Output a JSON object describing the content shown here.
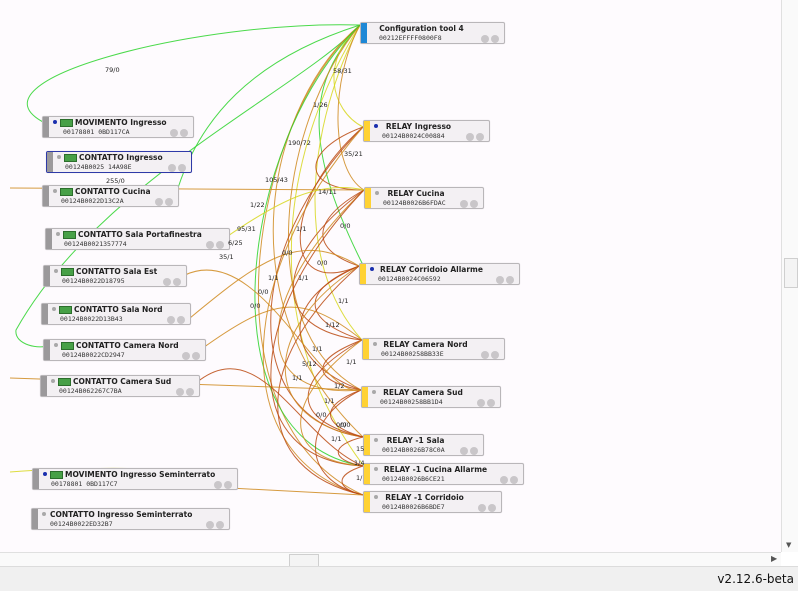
{
  "app": {
    "version": "v2.12.6-beta"
  },
  "colors": {
    "coordinator": "#1e88d6",
    "router": "#ffd233",
    "end_device": "#9b999b",
    "link_green": "#2bd42b",
    "link_yellow": "#d7d71e",
    "link_orange": "#cf8a1e",
    "link_red": "#bb4a12"
  },
  "nodes": [
    {
      "name": "Configuration tool 4",
      "id": "00212EFFFF0800F8",
      "kind": "coordinator"
    },
    {
      "name": "MOVIMENTO Ingresso",
      "id": "00178801 0BD117CA",
      "kind": "end_device"
    },
    {
      "name": "CONTATTO Ingresso",
      "id": "00124B0025 14A98E",
      "kind": "end_device"
    },
    {
      "name": "CONTATTO Cucina",
      "id": "00124B0022D13C2A",
      "kind": "end_device"
    },
    {
      "name": "CONTATTO Sala Portafinestra",
      "id": "00124B0021357774",
      "kind": "end_device"
    },
    {
      "name": "CONTATTO Sala Est",
      "id": "00124B0022D18795",
      "kind": "end_device"
    },
    {
      "name": "CONTATTO Sala Nord",
      "id": "00124B0022D13B43",
      "kind": "end_device"
    },
    {
      "name": "CONTATTO Camera Nord",
      "id": "00124B0022CD2947",
      "kind": "end_device"
    },
    {
      "name": "CONTATTO Camera Sud",
      "id": "00124B062267C7BA",
      "kind": "end_device"
    },
    {
      "name": "MOVIMENTO Ingresso Seminterrato",
      "id": "00178801 0BD117C7",
      "kind": "end_device"
    },
    {
      "name": "CONTATTO Ingresso Seminterrato",
      "id": "00124B0022ED32B7",
      "kind": "end_device"
    },
    {
      "name": "RELAY Ingresso",
      "id": "00124B0024C00884",
      "kind": "router"
    },
    {
      "name": "RELAY Cucina",
      "id": "00124B0026B6FDAC",
      "kind": "router"
    },
    {
      "name": "RELAY Corridoio Allarme",
      "id": "00124B0024C06592",
      "kind": "router"
    },
    {
      "name": "RELAY Camera Nord",
      "id": "00124B00258BB33E",
      "kind": "router"
    },
    {
      "name": "RELAY Camera Sud",
      "id": "00124B00258BB1D4",
      "kind": "router"
    },
    {
      "name": "RELAY -1 Sala",
      "id": "00124B0026B78C0A",
      "kind": "router"
    },
    {
      "name": "RELAY -1 Cucina Allarme",
      "id": "00124B0026B6CE21",
      "kind": "router"
    },
    {
      "name": "RELAY -1 Corridoio",
      "id": "00124B0026B6BDE7",
      "kind": "router"
    }
  ],
  "link_labels": [
    "79/0",
    "58/31",
    "1/26",
    "190/72",
    "35/21",
    "105/43",
    "14/11",
    "255/0",
    "1/22",
    "1/1",
    "0/0",
    "95/31",
    "6/25",
    "35/1",
    "0/0",
    "0/0",
    "1/1",
    "1/1",
    "0/0",
    "0/0",
    "1/12",
    "1/1",
    "5/12",
    "1/1",
    "1/1",
    "0/0",
    "1/2",
    "1/1",
    "0/0",
    "1/1",
    "0/0",
    "1/1",
    "15",
    "1/4",
    "1/"
  ]
}
